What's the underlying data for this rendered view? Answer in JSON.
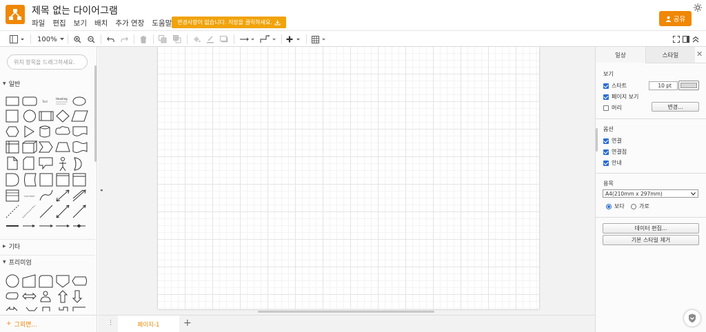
{
  "app": {
    "title": "제목 없는 다이어그램",
    "accent_color": "#f08705",
    "menu": [
      "파일",
      "편집",
      "보기",
      "배치",
      "추가 연장",
      "도움말"
    ],
    "unsaved_notice": "변경사항이 없습니다. 저장을 클릭하세요.",
    "share_label": "공유"
  },
  "toolbar": {
    "zoom": "100%",
    "icons": [
      "format-panel-icon",
      "zoom-in-icon",
      "zoom-out-icon",
      "undo-icon",
      "redo-icon",
      "delete-icon",
      "to-front-icon",
      "to-back-icon",
      "fill-color-icon",
      "line-color-icon",
      "shadow-icon",
      "connection-icon",
      "waypoints-icon",
      "insert-icon",
      "table-icon",
      "fullscreen-icon",
      "format-toggle-icon",
      "collapse-icon"
    ]
  },
  "left_panel": {
    "search_placeholder": "위치 항목을 드래그하세요.",
    "sections": [
      {
        "label": "일반",
        "expanded": true
      },
      {
        "label": "기타",
        "expanded": false
      },
      {
        "label": "프리미엄",
        "expanded": true
      }
    ],
    "general_text_items": [
      "Text",
      "Heading",
      "List item"
    ],
    "more_shapes_label": "그외면..."
  },
  "pages": {
    "tabs": [
      "페이지-1"
    ]
  },
  "format_panel": {
    "tabs": [
      "일상",
      "스타일"
    ],
    "view_section": {
      "heading": "보기",
      "grid_label": "스타트",
      "grid_checked": true,
      "grid_size": "10 pt",
      "page_view_label": "페이지 보기",
      "page_view_checked": true,
      "background_label": "머리",
      "background_checked": false,
      "change_button": "변경..."
    },
    "options_section": {
      "heading": "옵션",
      "items": [
        {
          "label": "연결",
          "checked": true
        },
        {
          "label": "연결점",
          "checked": true
        },
        {
          "label": "안내",
          "checked": true
        }
      ]
    },
    "paper_section": {
      "heading": "용목",
      "size": "A4(210mm x 297mm)",
      "portrait_label": "보다",
      "landscape_label": "가로",
      "orientation": "portrait"
    },
    "buttons": [
      "데이터 편집...",
      "기본 스타일 제거"
    ]
  }
}
